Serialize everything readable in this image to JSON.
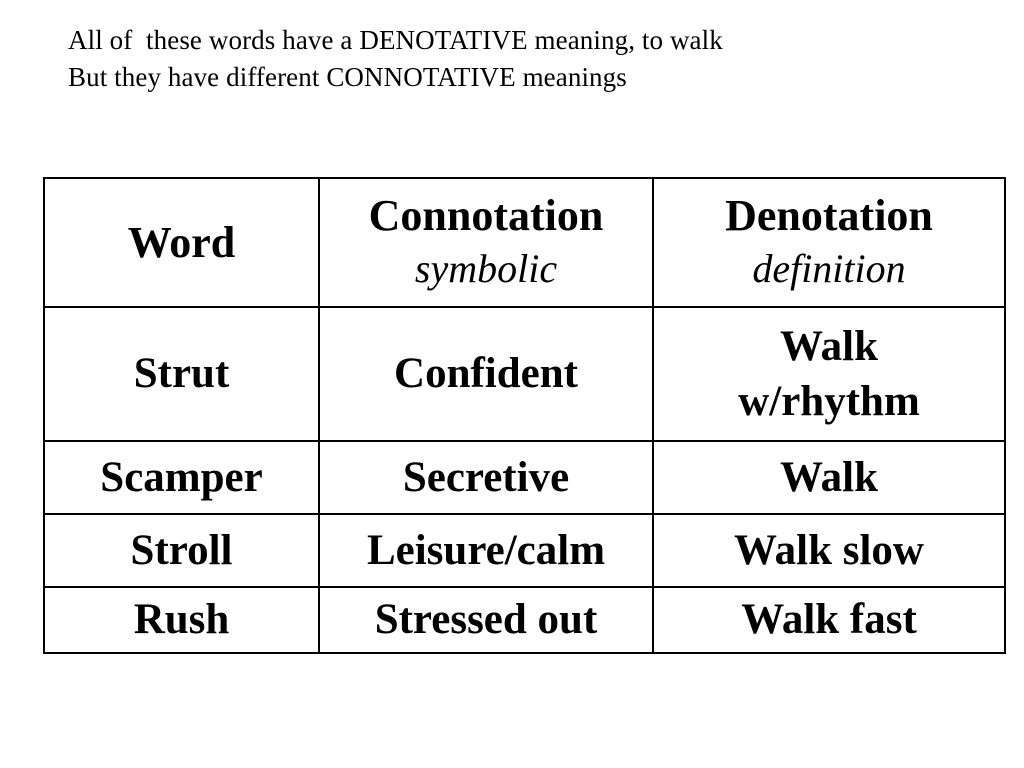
{
  "slide": {
    "background_color": "#ffffff",
    "text_color": "#000000",
    "accent_red": "#ec1111"
  },
  "heading": {
    "line1": "All of  these words have a DENOTATIVE meaning, to walk",
    "line2": "But they have different CONNOTATIVE meanings"
  },
  "table": {
    "columns": [
      {
        "title": "Word",
        "subtitle": ""
      },
      {
        "title": "Connotation",
        "subtitle": "symbolic"
      },
      {
        "title": "Denotation",
        "subtitle": "definition"
      }
    ],
    "rows": [
      {
        "word": "Strut",
        "word_color": "#ec1111",
        "connotation": "Confident",
        "connotation_color": "#ec1111",
        "denotation_line1": "Walk",
        "denotation_line2": "w/rhythm",
        "denotation_color": "#000000"
      },
      {
        "word": "Scamper",
        "word_color": "#ec1111",
        "connotation": "Secretive",
        "connotation_color": "#ec1111",
        "denotation_line1": "Walk",
        "denotation_line2": "",
        "denotation_color": "#000000"
      },
      {
        "word": "Stroll",
        "word_color": "#000000",
        "connotation": "Leisure/calm",
        "connotation_color": "#000000",
        "denotation_line1": "Walk slow",
        "denotation_line2": "",
        "denotation_color": "#000000"
      },
      {
        "word": "Rush",
        "word_color": "#000000",
        "connotation": "Stressed out",
        "connotation_color": "#000000",
        "denotation_line1": "Walk fast",
        "denotation_line2": "",
        "denotation_color": "#000000"
      }
    ]
  }
}
